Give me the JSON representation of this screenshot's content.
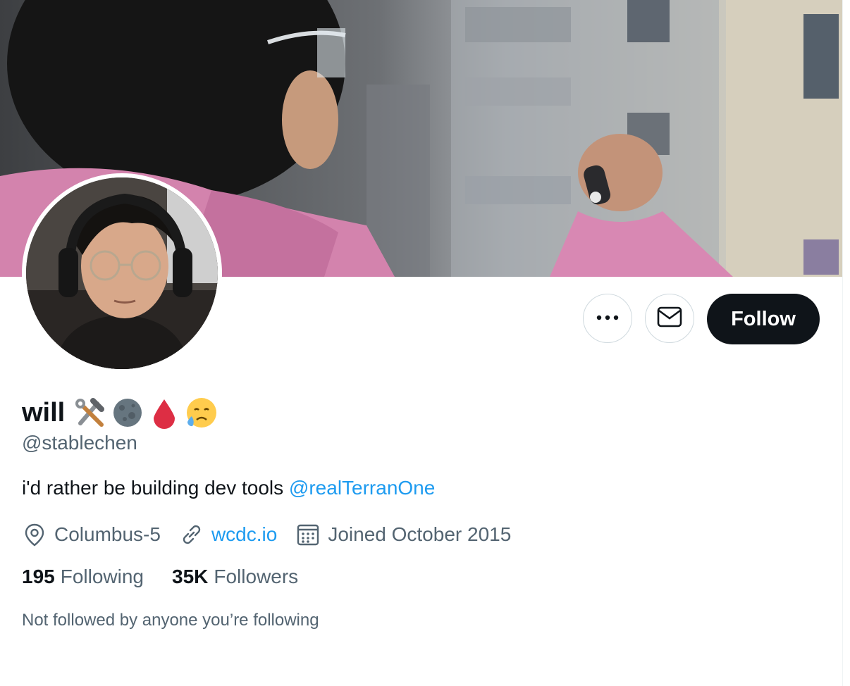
{
  "profile": {
    "name": "will",
    "name_emojis": [
      "hammer-and-wrench-emoji",
      "new-moon-emoji",
      "drop-of-blood-emoji",
      "sad-relieved-face-emoji"
    ],
    "handle": "@stablechen",
    "bio_text": "i'd rather be building dev tools ",
    "bio_mention": "@realTerranOne",
    "location": "Columbus-5",
    "website": "wcdc.io",
    "joined": "Joined October 2015",
    "following_count": "195",
    "following_label": "Following",
    "followers_count": "35K",
    "followers_label": "Followers",
    "mutuals_text": "Not followed by anyone you’re following"
  },
  "actions": {
    "follow_label": "Follow",
    "more_icon": "more-icon",
    "message_icon": "envelope-icon"
  },
  "colors": {
    "accent": "#1d9bf0",
    "text_primary": "#0f1419",
    "text_secondary": "#536471",
    "button_dark": "#0f1419"
  }
}
